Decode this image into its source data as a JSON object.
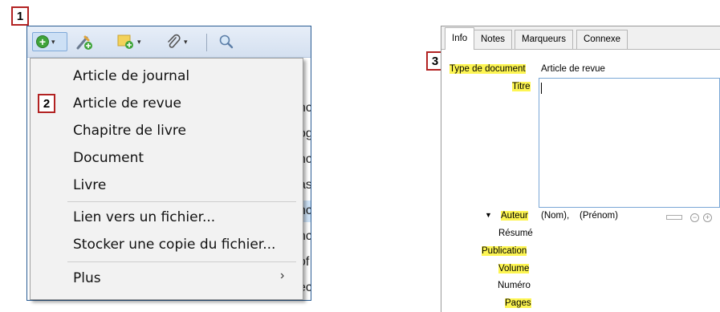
{
  "callouts": [
    "1",
    "2",
    "3"
  ],
  "left": {
    "toolbar": {
      "new_item_icon": "green-plus-circle-icon",
      "add_attachment_icon": "paperclip-icon",
      "search_icon": "magnifier-icon",
      "dropdown_arrow": "▾"
    },
    "menu": {
      "items": [
        "Article de journal",
        "Article de revue",
        "Chapitre de livre",
        "Document",
        "Livre"
      ],
      "file_items": [
        "Lien vers un fichier...",
        "Stocker une copie du fichier..."
      ],
      "more": "Plus",
      "more_arrow": "›"
    },
    "background_fragments": [
      "nc",
      "og",
      "nc",
      "as",
      "nc",
      "nc",
      "of",
      "ec"
    ]
  },
  "right": {
    "tabs": [
      "Info",
      "Notes",
      "Marqueurs",
      "Connexe"
    ],
    "fields": {
      "item_type_label": "Type de document",
      "item_type_value": "Article de revue",
      "title_label": "Titre",
      "author_label": "Auteur",
      "author_last": "(Nom),",
      "author_first": "(Prénom)",
      "abstract_label": "Résumé",
      "publication_label": "Publication",
      "volume_label": "Volume",
      "number_label": "Numéro",
      "pages_label": "Pages"
    },
    "author_buttons": [
      "−",
      "+"
    ],
    "colors": {
      "highlight": "#fdf552",
      "callout": "#b22222",
      "toolbar": "#dbe5f2"
    }
  }
}
